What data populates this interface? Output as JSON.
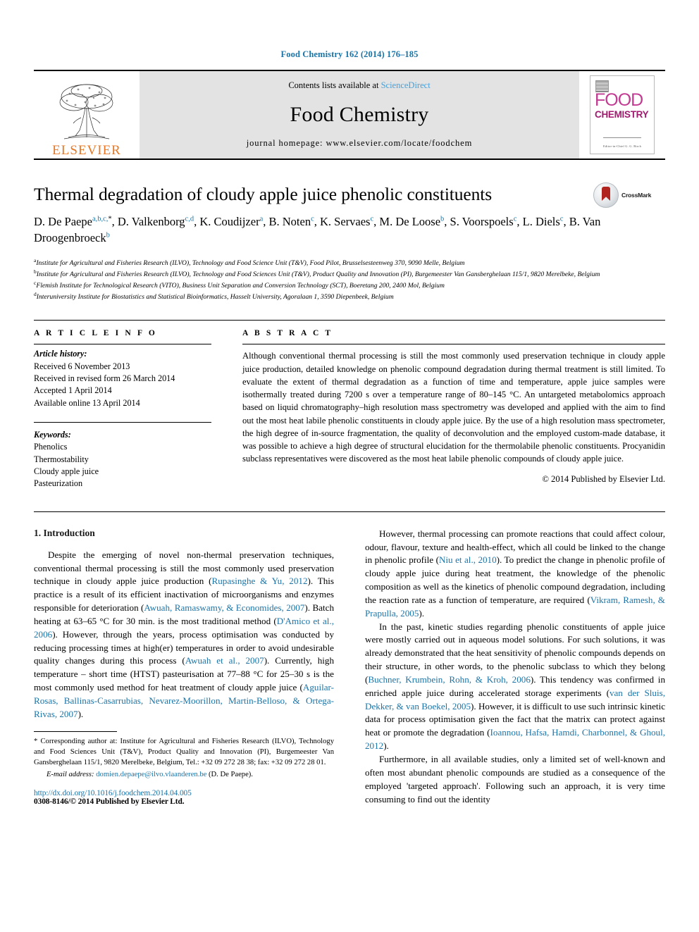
{
  "running_head": "Food Chemistry 162 (2014) 176–185",
  "masthead": {
    "contents_prefix": "Contents lists available at ",
    "sciencedirect": "ScienceDirect",
    "journal_name": "Food Chemistry",
    "homepage": "journal homepage: www.elsevier.com/locate/foodchem",
    "publisher_word": "ELSEVIER",
    "publisher_logo_icon": "elsevier-tree-icon",
    "cover": {
      "line1": "FOOD",
      "line2": "CHEMISTRY",
      "footer": "Editor-in-Chief  G. G. Birch"
    }
  },
  "article": {
    "title": "Thermal degradation of cloudy apple juice phenolic constituents",
    "crossmark_label": "CrossMark",
    "authors_line1": "D. De Paepe",
    "authors": [
      {
        "name": "D. De Paepe",
        "sup": "a,b,c,",
        "star": "*"
      },
      {
        "name": "D. Valkenborg",
        "sup": "c,d"
      },
      {
        "name": "K. Coudijzer",
        "sup": "a"
      },
      {
        "name": "B. Noten",
        "sup": "c"
      },
      {
        "name": "K. Servaes",
        "sup": "c"
      },
      {
        "name": "M. De Loose",
        "sup": "b"
      },
      {
        "name": "S. Voorspoels",
        "sup": "c"
      },
      {
        "name": "L. Diels",
        "sup": "c"
      },
      {
        "name": "B. Van Droogenbroeck",
        "sup": "b"
      }
    ],
    "affiliations": [
      {
        "mark": "a",
        "text": "Institute for Agricultural and Fisheries Research (ILVO), Technology and Food Science Unit (T&V), Food Pilot, Brusselsesteenweg 370, 9090 Melle, Belgium"
      },
      {
        "mark": "b",
        "text": "Institute for Agricultural and Fisheries Research (ILVO), Technology and Food Sciences Unit (T&V), Product Quality and Innovation (PI), Burgemeester Van Gansberghelaan 115/1, 9820 Merelbeke, Belgium"
      },
      {
        "mark": "c",
        "text": "Flemish Institute for Technological Research (VITO), Business Unit Separation and Conversion Technology (SCT), Boeretang 200, 2400 Mol, Belgium"
      },
      {
        "mark": "d",
        "text": "Interuniversity Institute for Biostatistics and Statistical Bioinformatics, Hasselt University, Agoralaan 1, 3590 Diepenbeek, Belgium"
      }
    ]
  },
  "article_info": {
    "heading": "A R T I C L E    I N F O",
    "history_label": "Article history:",
    "history": [
      "Received 6 November 2013",
      "Received in revised form 26 March 2014",
      "Accepted 1 April 2014",
      "Available online 13 April 2014"
    ],
    "keywords_label": "Keywords:",
    "keywords": [
      "Phenolics",
      "Thermostability",
      "Cloudy apple juice",
      "Pasteurization"
    ]
  },
  "abstract": {
    "heading": "A B S T R A C T",
    "text": "Although conventional thermal processing is still the most commonly used preservation technique in cloudy apple juice production, detailed knowledge on phenolic compound degradation during thermal treatment is still limited. To evaluate the extent of thermal degradation as a function of time and temperature, apple juice samples were isothermally treated during 7200 s over a temperature range of 80–145 °C. An untargeted metabolomics approach based on liquid chromatography–high resolution mass spectrometry was developed and applied with the aim to find out the most heat labile phenolic constituents in cloudy apple juice. By the use of a high resolution mass spectrometer, the high degree of in-source fragmentation, the quality of deconvolution and the employed custom-made database, it was possible to achieve a high degree of structural elucidation for the thermolabile phenolic constituents. Procyanidin subclass representatives were discovered as the most heat labile phenolic compounds of cloudy apple juice.",
    "copyright": "© 2014 Published by Elsevier Ltd."
  },
  "introduction": {
    "section_title": "1. Introduction",
    "left_paragraph_1": {
      "t1": "Despite the emerging of novel non-thermal preservation techniques, conventional thermal processing is still the most commonly used preservation technique in cloudy apple juice production (",
      "r1": "Rupasinghe & Yu, 2012",
      "t2": "). This practice is a result of its efficient inactivation of microorganisms and enzymes responsible for deterioration (",
      "r2": "Awuah, Ramaswamy, & Economides, 2007",
      "t3": "). Batch heating at 63–65 °C for 30 min. is the most traditional method (",
      "r3": "D'Amico et al., 2006",
      "t4": "). However, through the years, process optimisation was conducted by reducing processing times at high(er) temperatures in order to avoid undesirable quality changes during this process (",
      "r4": "Awuah et al., 2007",
      "t5": "). Currently, high temperature – short time (HTST) pasteurisation at 77–88 °C for 25–30 s is the most commonly used method for heat treatment of cloudy apple juice (",
      "r5": "Aguilar-Rosas, Ballinas-Casarrubias, Nevarez-Moorillon, Martin-Belloso, & Ortega-Rivas, 2007",
      "t6": ")."
    },
    "right_paragraph_1": {
      "t1": "However, thermal processing can promote reactions that could affect colour, odour, flavour, texture and health-effect, which all could be linked to the change in phenolic profile (",
      "r1": "Niu et al., 2010",
      "t2": "). To predict the change in phenolic profile of cloudy apple juice during heat treatment, the knowledge of the phenolic composition as well as the kinetics of phenolic compound degradation, including the reaction rate as a function of temperature, are required (",
      "r2": "Vikram, Ramesh, & Prapulla, 2005",
      "t3": ")."
    },
    "right_paragraph_2": {
      "t1": "In the past, kinetic studies regarding phenolic constituents of apple juice were mostly carried out in aqueous model solutions. For such solutions, it was already demonstrated that the heat sensitivity of phenolic compounds depends on their structure, in other words, to the phenolic subclass to which they belong (",
      "r1": "Buchner, Krumbein, Rohn, & Kroh, 2006",
      "t2": "). This tendency was confirmed in enriched apple juice during accelerated storage experiments (",
      "r2": "van der Sluis, Dekker, & van Boekel, 2005",
      "t3": "). However, it is difficult to use such intrinsic kinetic data for process optimisation given the fact that the matrix can protect against heat or promote the degradation (",
      "r3": "Ioannou, Hafsa, Hamdi, Charbonnel, & Ghoul, 2012",
      "t4": ")."
    },
    "right_paragraph_3": {
      "t1": "Furthermore, in all available studies, only a limited set of well-known and often most abundant phenolic compounds are studied as a consequence of the employed 'targeted approach'. Following such an approach, it is very time consuming to find out the identity"
    }
  },
  "footnote": {
    "star": "*",
    "text": " Corresponding author at: Institute for Agricultural and Fisheries Research (ILVO), Technology and Food Sciences Unit (T&V), Product Quality and Innovation (PI), Burgemeester Van Gansberghelaan 115/1, 9820 Merelbeke, Belgium, Tel.: +32 09 272 28 38; fax: +32 09 272 28 01.",
    "email_label": "E-mail address:",
    "email": "domien.depaepe@ilvo.vlaanderen.be",
    "email_suffix": " (D. De Paepe).",
    "doi": "http://dx.doi.org/10.1016/j.foodchem.2014.04.005",
    "issn": "0308-8146/© 2014 Published by Elsevier Ltd."
  },
  "colors": {
    "link": "#1a74a8",
    "masthead_bg": "#e3e3e3",
    "elsevier_orange": "#E87722",
    "cover_magenta": "#c13b92"
  }
}
